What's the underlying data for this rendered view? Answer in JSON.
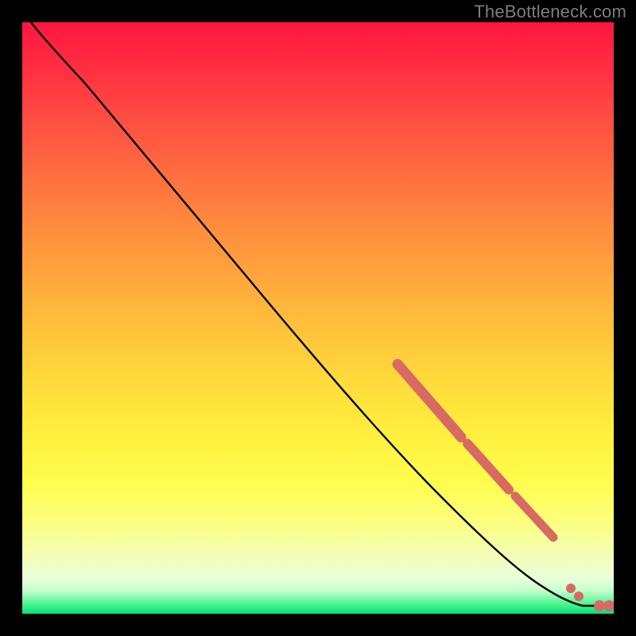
{
  "watermark": "TheBottleneck.com",
  "chart_data": {
    "type": "line",
    "title": "",
    "xlabel": "",
    "ylabel": "",
    "xlim": [
      0,
      100
    ],
    "ylim": [
      0,
      100
    ],
    "curve": [
      {
        "x": 1.5,
        "y": 100
      },
      {
        "x": 4,
        "y": 98
      },
      {
        "x": 8,
        "y": 95
      },
      {
        "x": 15,
        "y": 87
      },
      {
        "x": 25,
        "y": 74
      },
      {
        "x": 35,
        "y": 62
      },
      {
        "x": 45,
        "y": 50
      },
      {
        "x": 55,
        "y": 38
      },
      {
        "x": 65,
        "y": 27
      },
      {
        "x": 72,
        "y": 19
      },
      {
        "x": 78,
        "y": 13
      },
      {
        "x": 83,
        "y": 9
      },
      {
        "x": 88,
        "y": 5
      },
      {
        "x": 92,
        "y": 2.4
      },
      {
        "x": 95,
        "y": 1.5
      },
      {
        "x": 97.5,
        "y": 1.3
      },
      {
        "x": 99,
        "y": 1.3
      }
    ],
    "marker_clusters": [
      {
        "x_start": 64,
        "x_end": 74,
        "count_estimate": 12
      },
      {
        "x_start": 75,
        "x_end": 82,
        "count_estimate": 8
      },
      {
        "x_start": 83,
        "x_end": 90,
        "count_estimate": 6
      },
      {
        "x_start": 92,
        "x_end": 93,
        "count_estimate": 1
      },
      {
        "x_start": 97,
        "x_end": 99,
        "count_estimate": 2
      }
    ],
    "marker_color": "#d86a64",
    "line_color": "#000000"
  }
}
